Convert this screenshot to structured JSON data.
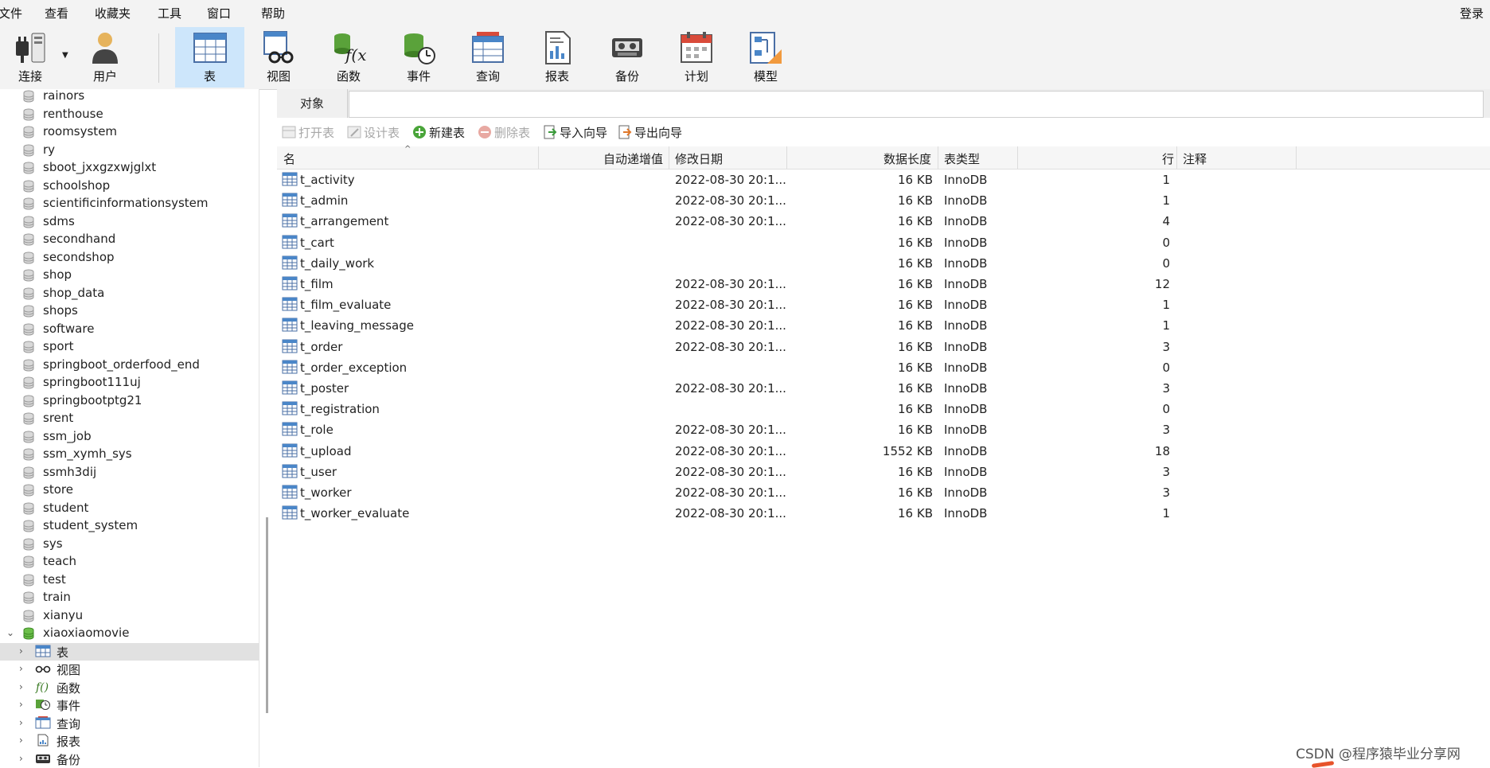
{
  "menu": [
    "文件",
    "查看",
    "收藏夹",
    "工具",
    "窗口",
    "帮助"
  ],
  "login": "登录",
  "ribbon": {
    "connect": "连接",
    "user": "用户",
    "buttons": [
      "表",
      "视图",
      "函数",
      "事件",
      "查询",
      "报表",
      "备份",
      "计划",
      "模型"
    ],
    "active": "表"
  },
  "sidebar": {
    "databases": [
      "rainors",
      "renthouse",
      "roomsystem",
      "ry",
      "sboot_jxxgzxwjglxt",
      "schoolshop",
      "scientificinformationsystem",
      "sdms",
      "secondhand",
      "secondshop",
      "shop",
      "shop_data",
      "shops",
      "software",
      "sport",
      "springboot_orderfood_end",
      "springboot111uj",
      "springbootptg21",
      "srent",
      "ssm_job",
      "ssm_xymh_sys",
      "ssmh3dij",
      "store",
      "student",
      "student_system",
      "sys",
      "teach",
      "test",
      "train",
      "xianyu"
    ],
    "open_db": "xiaoxiaomovie",
    "children": [
      "表",
      "视图",
      "函数",
      "事件",
      "查询",
      "报表",
      "备份"
    ]
  },
  "object_tab": "对象",
  "toolbar": {
    "open": "打开表",
    "design": "设计表",
    "new": "新建表",
    "delete": "删除表",
    "import": "导入向导",
    "export": "导出向导"
  },
  "columns": {
    "name": "名",
    "auto_inc": "自动递增值",
    "modified": "修改日期",
    "data_len": "数据长度",
    "engine": "表类型",
    "rows": "行",
    "comment": "注释"
  },
  "tables": [
    {
      "name": "t_activity",
      "modified": "2022-08-30 20:1...",
      "size": "16 KB",
      "engine": "InnoDB",
      "rows": "1"
    },
    {
      "name": "t_admin",
      "modified": "2022-08-30 20:1...",
      "size": "16 KB",
      "engine": "InnoDB",
      "rows": "1"
    },
    {
      "name": "t_arrangement",
      "modified": "2022-08-30 20:1...",
      "size": "16 KB",
      "engine": "InnoDB",
      "rows": "4"
    },
    {
      "name": "t_cart",
      "modified": "",
      "size": "16 KB",
      "engine": "InnoDB",
      "rows": "0"
    },
    {
      "name": "t_daily_work",
      "modified": "",
      "size": "16 KB",
      "engine": "InnoDB",
      "rows": "0"
    },
    {
      "name": "t_film",
      "modified": "2022-08-30 20:1...",
      "size": "16 KB",
      "engine": "InnoDB",
      "rows": "12"
    },
    {
      "name": "t_film_evaluate",
      "modified": "2022-08-30 20:1...",
      "size": "16 KB",
      "engine": "InnoDB",
      "rows": "1"
    },
    {
      "name": "t_leaving_message",
      "modified": "2022-08-30 20:1...",
      "size": "16 KB",
      "engine": "InnoDB",
      "rows": "1"
    },
    {
      "name": "t_order",
      "modified": "2022-08-30 20:1...",
      "size": "16 KB",
      "engine": "InnoDB",
      "rows": "3"
    },
    {
      "name": "t_order_exception",
      "modified": "",
      "size": "16 KB",
      "engine": "InnoDB",
      "rows": "0"
    },
    {
      "name": "t_poster",
      "modified": "2022-08-30 20:1...",
      "size": "16 KB",
      "engine": "InnoDB",
      "rows": "3"
    },
    {
      "name": "t_registration",
      "modified": "",
      "size": "16 KB",
      "engine": "InnoDB",
      "rows": "0"
    },
    {
      "name": "t_role",
      "modified": "2022-08-30 20:1...",
      "size": "16 KB",
      "engine": "InnoDB",
      "rows": "3"
    },
    {
      "name": "t_upload",
      "modified": "2022-08-30 20:1...",
      "size": "1552 KB",
      "engine": "InnoDB",
      "rows": "18"
    },
    {
      "name": "t_user",
      "modified": "2022-08-30 20:1...",
      "size": "16 KB",
      "engine": "InnoDB",
      "rows": "3"
    },
    {
      "name": "t_worker",
      "modified": "2022-08-30 20:1...",
      "size": "16 KB",
      "engine": "InnoDB",
      "rows": "3"
    },
    {
      "name": "t_worker_evaluate",
      "modified": "2022-08-30 20:1...",
      "size": "16 KB",
      "engine": "InnoDB",
      "rows": "1"
    }
  ],
  "watermark": "CSDN @程序猿毕业分享网"
}
